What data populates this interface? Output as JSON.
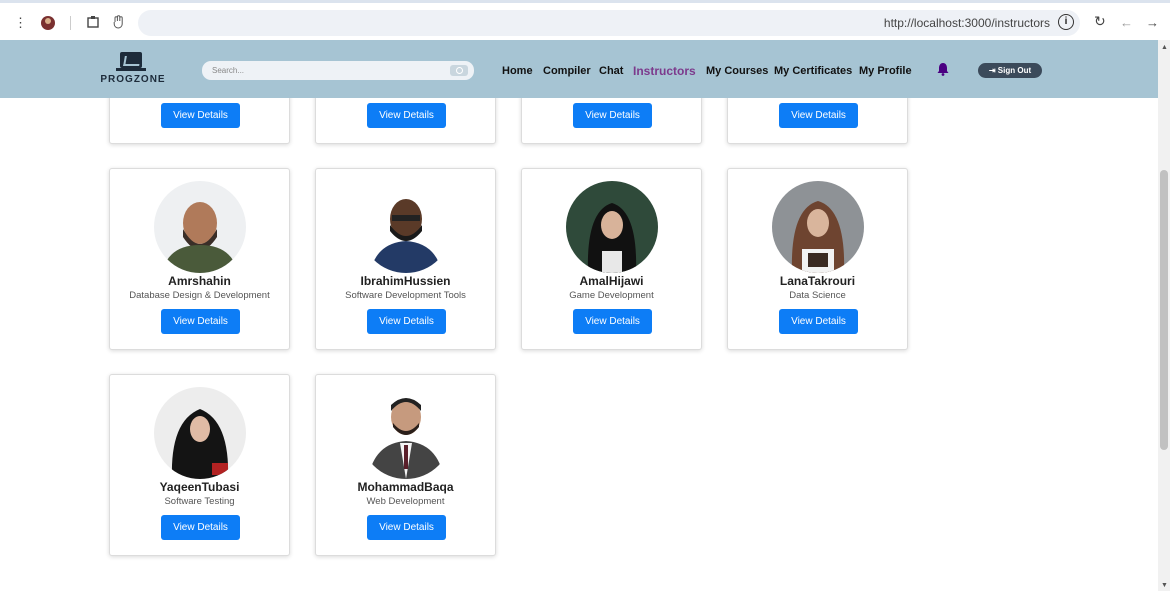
{
  "browser": {
    "url": "http://localhost:3000/instructors",
    "info_glyph": "i"
  },
  "navbar": {
    "logo_text": "PROGZONE",
    "search_placeholder": "Search...",
    "links": [
      "Home",
      "Compiler",
      "Chat",
      "Instructors",
      "My Courses",
      "My Certificates",
      "My Profile"
    ],
    "active_link": "Instructors",
    "signout_label": "Sign Out",
    "signout_icon": "sign-out-icon",
    "bell_color": "#4b0082",
    "active_color": "#7c3a8c",
    "bar_color": "#a6c4d3"
  },
  "button_label": "View Details",
  "button_color": "#0d7df6",
  "top_row_button_label": "View Details",
  "instructors": [
    {
      "name": "Amrshahin",
      "field": "Database Design & Development"
    },
    {
      "name": "IbrahimHussien",
      "field": "Software Development Tools"
    },
    {
      "name": "AmalHijawi",
      "field": "Game Development"
    },
    {
      "name": "LanaTakrouri",
      "field": "Data Science"
    },
    {
      "name": "YaqeenTubasi",
      "field": "Software Testing"
    },
    {
      "name": "MohammadBaqa",
      "field": "Web Development"
    }
  ]
}
